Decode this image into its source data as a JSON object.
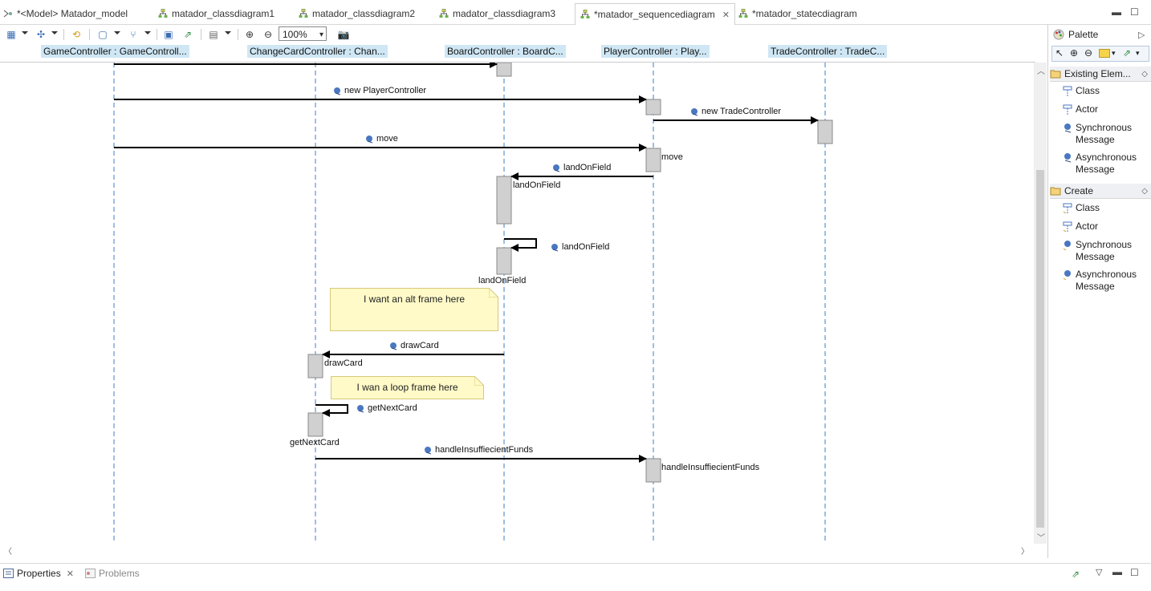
{
  "tabs": [
    {
      "label": "*<Model> Matador_model",
      "icon": "model-icon"
    },
    {
      "label": "matador_classdiagram1",
      "icon": "diagram-icon"
    },
    {
      "label": "matador_classdiagram2",
      "icon": "diagram-icon"
    },
    {
      "label": "madator_classdiagram3",
      "icon": "diagram-icon"
    },
    {
      "label": "*matador_sequencediagram",
      "icon": "diagram-icon",
      "active": true
    },
    {
      "label": "*matador_statecdiagram",
      "icon": "diagram-icon"
    }
  ],
  "toolbar": {
    "zoom": "100%"
  },
  "lifelines": [
    {
      "label": "GameController : GameControll..."
    },
    {
      "label": "ChangeCardController : Chan..."
    },
    {
      "label": "BoardController : BoardC..."
    },
    {
      "label": "PlayerController : Play..."
    },
    {
      "label": "TradeController : TradeC..."
    }
  ],
  "messages": [
    {
      "label": "new PlayerController"
    },
    {
      "label": "new TradeController"
    },
    {
      "label": "move"
    },
    {
      "label": "landOnField"
    },
    {
      "label": "landOnField"
    },
    {
      "label": "drawCard"
    },
    {
      "label": "getNextCard"
    },
    {
      "label": "handleInsuffiecientFunds"
    }
  ],
  "activation_labels": [
    {
      "label": "move"
    },
    {
      "label": "landOnField"
    },
    {
      "label": "landOnField"
    },
    {
      "label": "drawCard"
    },
    {
      "label": "getNextCard"
    },
    {
      "label": "handleInsuffiecientFunds"
    }
  ],
  "notes": [
    {
      "text": "I want an alt frame here"
    },
    {
      "text": "I wan a loop frame here"
    }
  ],
  "palette": {
    "title": "Palette",
    "drawers": [
      {
        "label": "Existing Elem...",
        "items": [
          "Class",
          "Actor",
          "Synchronous Message",
          "Asynchronous Message"
        ]
      },
      {
        "label": "Create",
        "items": [
          "Class",
          "Actor",
          "Synchronous Message",
          "Asynchronous Message"
        ]
      }
    ]
  },
  "bottom_tabs": [
    {
      "label": "Properties"
    },
    {
      "label": "Problems"
    }
  ],
  "colors": {
    "lifeline_header": "#cfe7f5",
    "lifeline_dash": "#3a7fc4",
    "activation": "#d0d0d0",
    "note": "#fffac8"
  }
}
